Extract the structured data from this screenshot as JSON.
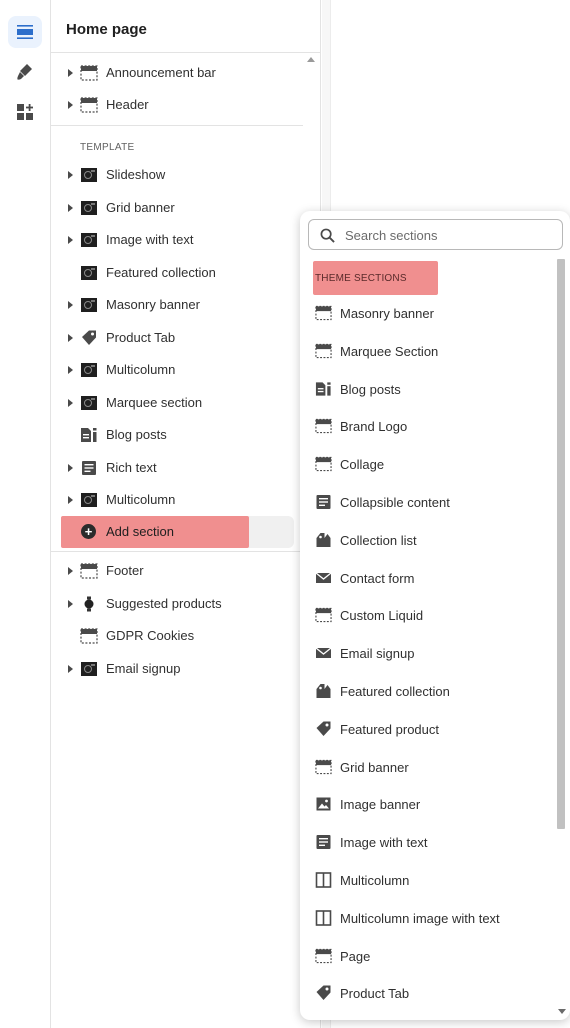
{
  "rail": {
    "items": [
      {
        "icon": "sections-icon",
        "active": true
      },
      {
        "icon": "theme-settings-icon",
        "active": false
      },
      {
        "icon": "app-blocks-icon",
        "active": false
      }
    ]
  },
  "panel": {
    "title": "Home page",
    "header_sections": [
      {
        "label": "Announcement bar",
        "icon": "section-bar-icon",
        "expandable": true
      },
      {
        "label": "Header",
        "icon": "section-bar-icon",
        "expandable": true
      }
    ],
    "template_label": "TEMPLATE",
    "template_sections": [
      {
        "label": "Slideshow",
        "icon": "thumbnail-icon",
        "expandable": true
      },
      {
        "label": "Grid banner",
        "icon": "thumbnail-icon",
        "expandable": true
      },
      {
        "label": "Image with text",
        "icon": "thumbnail-icon",
        "expandable": true
      },
      {
        "label": "Featured collection",
        "icon": "thumbnail-icon",
        "expandable": false
      },
      {
        "label": "Masonry banner",
        "icon": "thumbnail-icon",
        "expandable": true
      },
      {
        "label": "Product Tab",
        "icon": "tag-icon",
        "expandable": true
      },
      {
        "label": "Multicolumn",
        "icon": "thumbnail-icon",
        "expandable": true
      },
      {
        "label": "Marquee section",
        "icon": "thumbnail-icon",
        "expandable": true
      },
      {
        "label": "Blog posts",
        "icon": "blog-icon",
        "expandable": false
      },
      {
        "label": "Rich text",
        "icon": "text-icon",
        "expandable": true
      },
      {
        "label": "Multicolumn",
        "icon": "thumbnail-icon",
        "expandable": true
      }
    ],
    "add_section_label": "Add section",
    "footer_sections": [
      {
        "label": "Footer",
        "icon": "section-bar-icon",
        "expandable": true
      },
      {
        "label": "Suggested products",
        "icon": "watch-icon",
        "expandable": true
      },
      {
        "label": "GDPR Cookies",
        "icon": "section-bar-icon",
        "expandable": false
      },
      {
        "label": "Email signup",
        "icon": "thumbnail-icon",
        "expandable": true
      }
    ]
  },
  "popover": {
    "search_placeholder": "Search sections",
    "group_label": "THEME SECTIONS",
    "items": [
      {
        "label": "Masonry banner",
        "icon": "section-bar-icon"
      },
      {
        "label": "Marquee Section",
        "icon": "section-bar-icon"
      },
      {
        "label": "Blog posts",
        "icon": "blog-icon"
      },
      {
        "label": "Brand Logo",
        "icon": "section-bar-icon"
      },
      {
        "label": "Collage",
        "icon": "section-bar-icon"
      },
      {
        "label": "Collapsible content",
        "icon": "text-icon"
      },
      {
        "label": "Collection list",
        "icon": "collection-icon"
      },
      {
        "label": "Contact form",
        "icon": "envelope-icon"
      },
      {
        "label": "Custom Liquid",
        "icon": "section-bar-icon"
      },
      {
        "label": "Email signup",
        "icon": "envelope-icon"
      },
      {
        "label": "Featured collection",
        "icon": "collection-icon"
      },
      {
        "label": "Featured product",
        "icon": "tag-icon"
      },
      {
        "label": "Grid banner",
        "icon": "section-bar-icon"
      },
      {
        "label": "Image banner",
        "icon": "image-icon"
      },
      {
        "label": "Image with text",
        "icon": "text-icon"
      },
      {
        "label": "Multicolumn",
        "icon": "columns-icon"
      },
      {
        "label": "Multicolumn image with text",
        "icon": "columns-icon"
      },
      {
        "label": "Page",
        "icon": "section-bar-icon"
      },
      {
        "label": "Product Tab",
        "icon": "tag-icon"
      }
    ]
  },
  "colors": {
    "highlight": "#f08f8f",
    "active_rail": "#2c6ecb"
  }
}
